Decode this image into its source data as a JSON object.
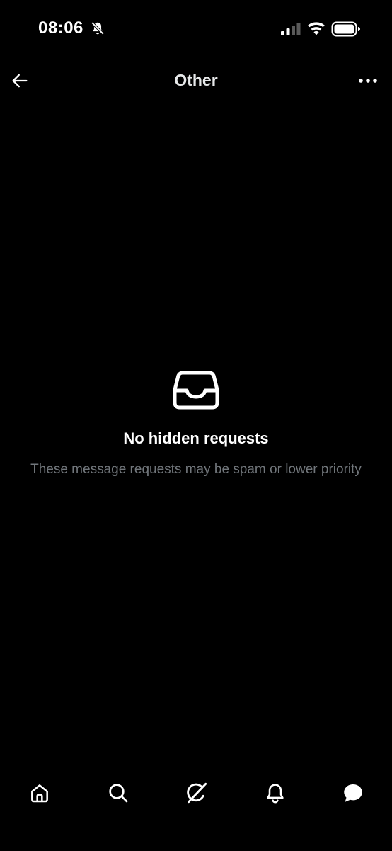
{
  "status_bar": {
    "time": "08:06"
  },
  "header": {
    "title": "Other"
  },
  "empty_state": {
    "title": "No hidden requests",
    "subtitle": "These message requests may be spam or lower priority"
  },
  "icons": {
    "back": "arrow-left-icon",
    "more": "more-horizontal-icon",
    "inbox": "inbox-tray-icon",
    "home": "home-icon",
    "search": "search-icon",
    "grok": "grok-icon",
    "notifications": "bell-icon",
    "messages": "message-bubble-icon"
  },
  "colors": {
    "background": "#000000",
    "primary_text": "#ffffff",
    "secondary_text": "#71767b",
    "divider": "#2f3336"
  }
}
